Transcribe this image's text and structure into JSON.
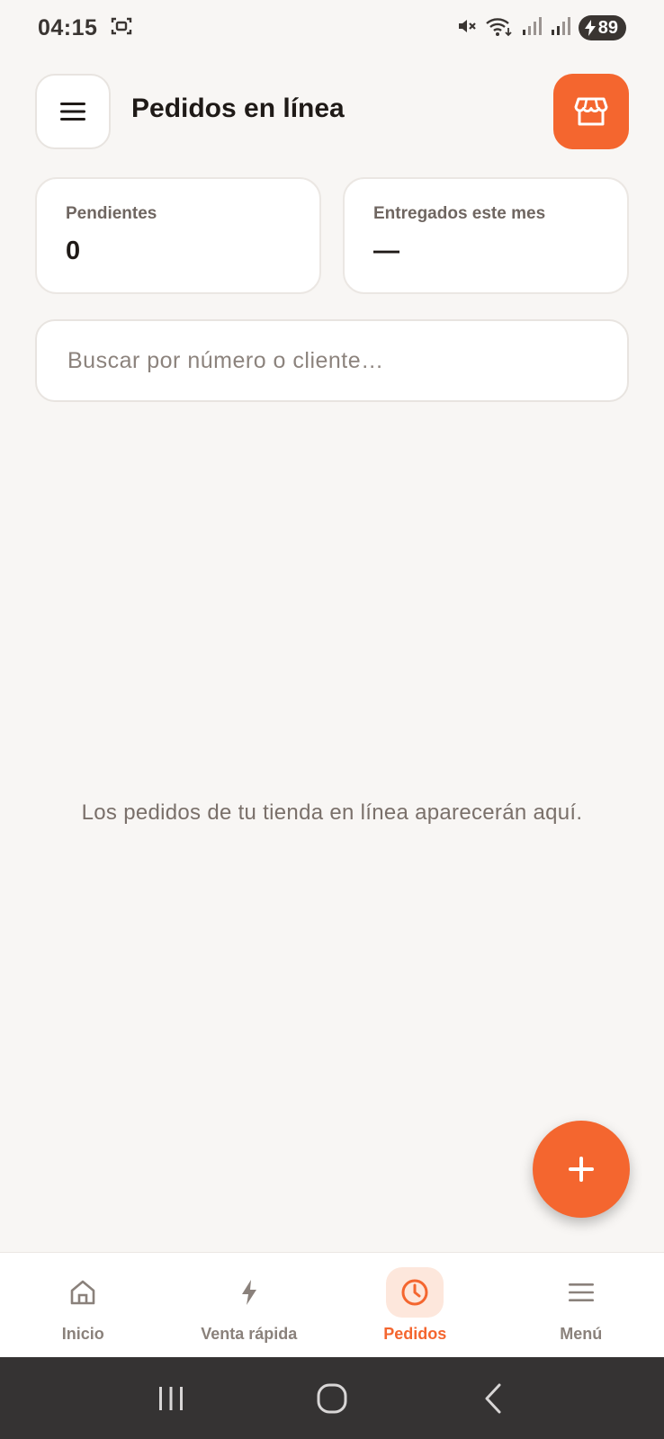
{
  "status_bar": {
    "time": "04:15",
    "battery": "89"
  },
  "header": {
    "title": "Pedidos en línea",
    "menu_icon": "hamburger-icon",
    "store_icon": "store-icon"
  },
  "stats": {
    "pending_label": "Pendientes",
    "pending_value": "0",
    "delivered_label": "Entregados este mes",
    "delivered_value": "—"
  },
  "search": {
    "placeholder": "Buscar por número o cliente…",
    "value": ""
  },
  "empty_state": {
    "message": "Los pedidos de tu tienda en línea aparecerán aquí."
  },
  "fab": {
    "icon": "plus-icon"
  },
  "bottom_nav": {
    "items": [
      {
        "label": "Inicio",
        "icon": "home-icon",
        "active": false
      },
      {
        "label": "Venta rápida",
        "icon": "lightning-icon",
        "active": false
      },
      {
        "label": "Pedidos",
        "icon": "clock-icon",
        "active": true
      },
      {
        "label": "Menú",
        "icon": "menu-lines-icon",
        "active": false
      }
    ]
  },
  "colors": {
    "accent": "#f4662f",
    "accent_soft": "#fde7dc",
    "background": "#f8f6f4",
    "muted_text": "#7a706a"
  }
}
